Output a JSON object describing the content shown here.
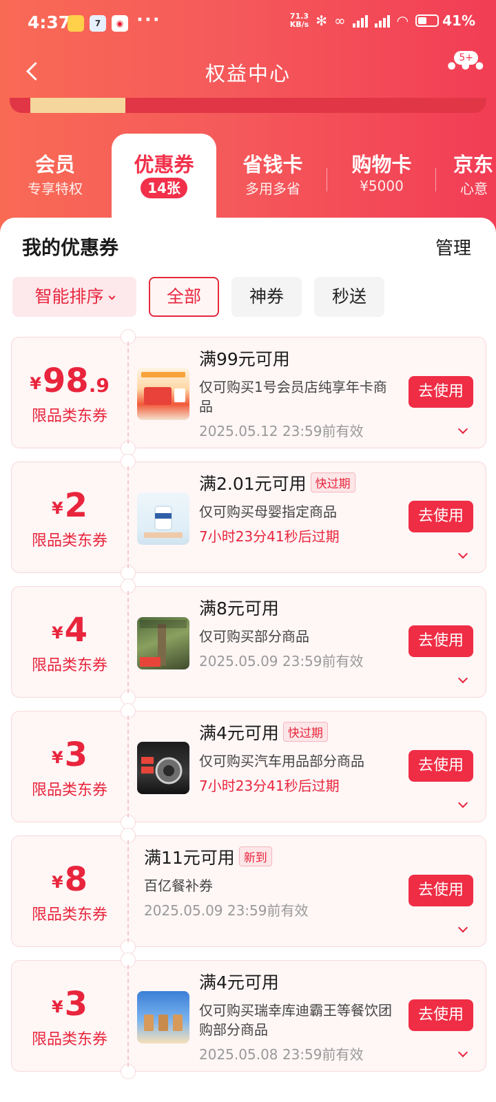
{
  "status_bar": {
    "time": "4:37",
    "net_speed_value": "71.3",
    "net_speed_unit": "KB/s",
    "battery": "41%",
    "icons": [
      "notes-app-icon",
      "calendar-app-icon",
      "weibo-app-icon",
      "bluetooth-icon",
      "nfc-icon",
      "signal-hd-icon",
      "signal-hd-icon",
      "wifi-icon",
      "battery-icon"
    ],
    "calendar_day": "7"
  },
  "navbar": {
    "title": "权益中心",
    "more_badge": "5+"
  },
  "tabs": [
    {
      "title": "会员",
      "subtitle": "专享特权"
    },
    {
      "title": "优惠券",
      "subtitle": "14张",
      "active": true
    },
    {
      "title": "省钱卡",
      "subtitle": "多用多省"
    },
    {
      "title": "购物卡",
      "subtitle": "¥5000"
    },
    {
      "title": "京东",
      "subtitle": "心意"
    }
  ],
  "panel": {
    "title": "我的优惠券",
    "manage": "管理"
  },
  "filters": {
    "sort": "智能排序",
    "all": "全部",
    "god": "神券",
    "instant": "秒送"
  },
  "coupons": [
    {
      "yen": "¥",
      "amount": "98",
      "decimal": ".9",
      "type": "限品类东券",
      "title": "满99元可用",
      "tag": "",
      "desc": "仅可购买1号会员店纯享年卡商品",
      "expiry": "2025.05.12 23:59前有效",
      "urgent": false,
      "button": "去使用"
    },
    {
      "yen": "¥",
      "amount": "2",
      "decimal": "",
      "type": "限品类东券",
      "title": "满2.01元可用",
      "tag": "快过期",
      "desc": "仅可购买母婴指定商品",
      "expiry": "7小时23分41秒后过期",
      "urgent": true,
      "button": "去使用"
    },
    {
      "yen": "¥",
      "amount": "4",
      "decimal": "",
      "type": "限品类东券",
      "title": "满8元可用",
      "tag": "",
      "desc": "仅可购买部分商品",
      "expiry": "2025.05.09 23:59前有效",
      "urgent": false,
      "button": "去使用"
    },
    {
      "yen": "¥",
      "amount": "3",
      "decimal": "",
      "type": "限品类东券",
      "title": "满4元可用",
      "tag": "快过期",
      "desc": "仅可购买汽车用品部分商品",
      "expiry": "7小时23分41秒后过期",
      "urgent": true,
      "button": "去使用"
    },
    {
      "yen": "¥",
      "amount": "8",
      "decimal": "",
      "type": "限品类东券",
      "title": "满11元可用",
      "tag": "新到",
      "desc": "百亿餐补券",
      "expiry": "2025.05.09 23:59前有效",
      "urgent": false,
      "button": "去使用"
    },
    {
      "yen": "¥",
      "amount": "3",
      "decimal": "",
      "type": "限品类东券",
      "title": "满4元可用",
      "tag": "",
      "desc": "仅可购买瑞幸库迪霸王等餐饮团购部分商品",
      "expiry": "2025.05.08 23:59前有效",
      "urgent": false,
      "button": "去使用"
    }
  ],
  "colors": {
    "brand_red": "#ef2d45",
    "header_start": "#f96a55",
    "header_end": "#f23d55",
    "coupon_bg": "#fff6f6"
  }
}
